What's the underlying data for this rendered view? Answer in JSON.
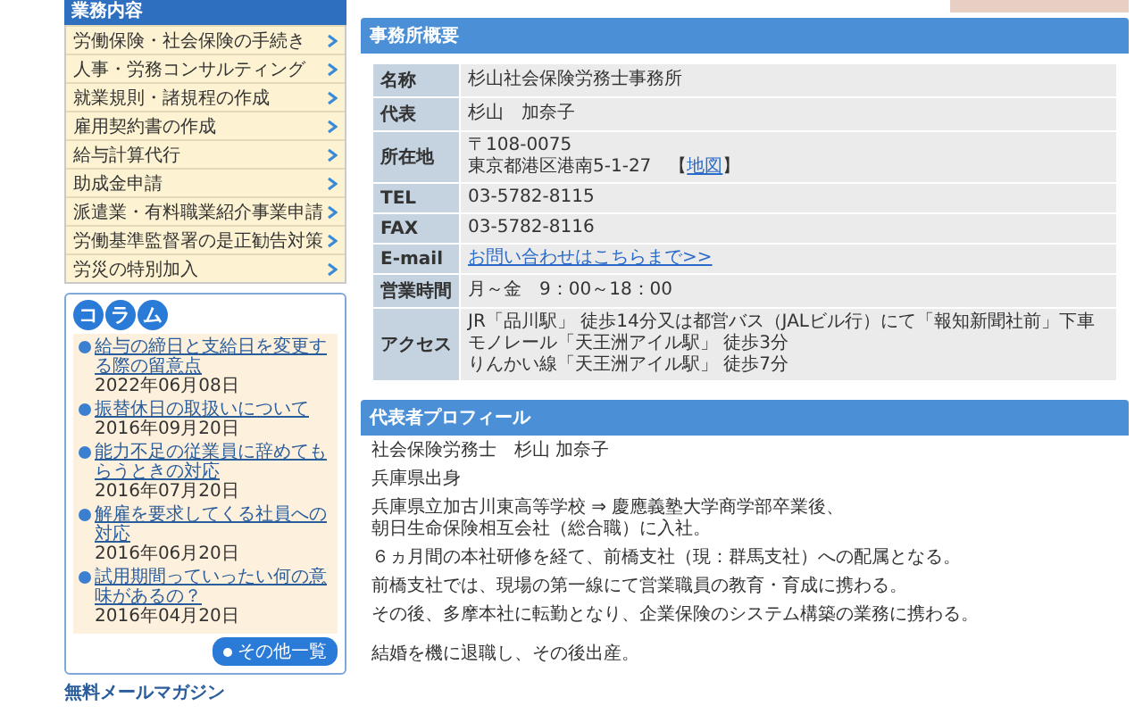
{
  "sidebar": {
    "menu_title": "業務内容",
    "menu_items": [
      "労働保険・社会保険の手続き",
      "人事・労務コンサルティング",
      "就業規則・諸規程の作成",
      "雇用契約書の作成",
      "給与計算代行",
      "助成金申請",
      "派遣業・有料職業紹介事業申請",
      "労働基準監督署の是正勧告対策",
      "労災の特別加入"
    ],
    "column": {
      "title_chars": [
        "コ",
        "ラ",
        "ム"
      ],
      "entries": [
        {
          "title": "給与の締日と支給日を変更する際の留意点",
          "date": "2022年06月08日"
        },
        {
          "title": "振替休日の取扱いについて",
          "date": "2016年09月20日"
        },
        {
          "title": "能力不足の従業員に辞めてもらうときの対応",
          "date": "2016年07月20日"
        },
        {
          "title": "解雇を要求してくる社員への対応",
          "date": "2016年06月20日"
        },
        {
          "title": "試用期間っていったい何の意味があるの？",
          "date": "2016年04月20日"
        }
      ],
      "more_button": "その他一覧"
    },
    "magazine_link": "無料メールマガジン"
  },
  "main": {
    "office": {
      "heading": "事務所概要",
      "rows": [
        {
          "label": "名称",
          "lines": [
            [
              {
                "text": "杉山社会保険労務士事務所",
                "kind": "text"
              }
            ]
          ]
        },
        {
          "label": "代表",
          "lines": [
            [
              {
                "text": "杉山　加奈子",
                "kind": "text"
              }
            ]
          ]
        },
        {
          "label": "所在地",
          "lines": [
            [
              {
                "text": "〒108-0075",
                "kind": "text"
              }
            ],
            [
              {
                "text": "東京都港区港南5-1-27　【",
                "kind": "text"
              },
              {
                "text": "地図",
                "kind": "link"
              },
              {
                "text": "】",
                "kind": "text"
              }
            ]
          ]
        },
        {
          "label": "TEL",
          "lines": [
            [
              {
                "text": "03-5782-8115",
                "kind": "text"
              }
            ]
          ]
        },
        {
          "label": "FAX",
          "lines": [
            [
              {
                "text": "03-5782-8116",
                "kind": "text"
              }
            ]
          ]
        },
        {
          "label": "E-mail",
          "lines": [
            [
              {
                "text": "お問い合わせはこちらまで>>",
                "kind": "link"
              }
            ]
          ]
        },
        {
          "label": "営業時間",
          "lines": [
            [
              {
                "text": "月～金　9：00～18：00",
                "kind": "text"
              }
            ]
          ]
        },
        {
          "label": "アクセス",
          "lines": [
            [
              {
                "text": "JR「品川駅」 徒歩14分又は都営バス（JALビル行）にて「報知新聞社前」下車",
                "kind": "text"
              }
            ],
            [
              {
                "text": "モノレール「天王洲アイル駅」 徒歩3分",
                "kind": "text"
              }
            ],
            [
              {
                "text": "りんかい線「天王洲アイル駅」 徒歩7分",
                "kind": "text"
              }
            ]
          ]
        }
      ]
    },
    "profile": {
      "heading": "代表者プロフィール",
      "paragraphs": [
        [
          "社会保険労務士　杉山 加奈子"
        ],
        [
          "兵庫県出身"
        ],
        [
          "兵庫県立加古川東高等学校 ⇒ 慶應義塾大学商学部卒業後、",
          "朝日生命保険相互会社（総合職）に入社。"
        ],
        [
          "６ヵ月間の本社研修を経て、前橋支社（現：群馬支社）への配属となる。"
        ],
        [
          "前橋支社では、現場の第一線にて営業職員の教育・育成に携わる。"
        ],
        [
          "その後、多摩本社に転勤となり、企業保険のシステム構築の業務に携わる。"
        ],
        [
          "結婚を機に退職し、その後出産。"
        ]
      ]
    }
  }
}
